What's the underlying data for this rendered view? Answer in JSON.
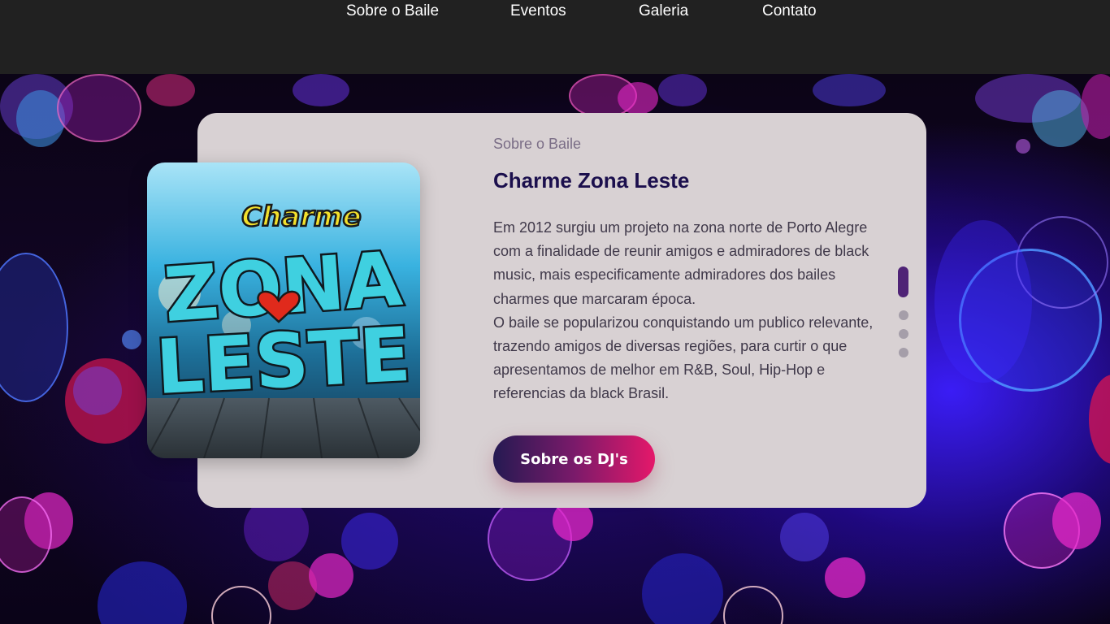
{
  "nav": {
    "items": [
      {
        "label": "Sobre o Baile"
      },
      {
        "label": "Eventos"
      },
      {
        "label": "Galeria"
      },
      {
        "label": "Contato"
      }
    ]
  },
  "about": {
    "subtitle": "Sobre o Baile",
    "title": "Charme Zona Leste",
    "paragraphs": [
      "Em 2012 surgiu um projeto na zona norte de Porto Alegre com a finalidade de reunir amigos e admiradores de black music, mais especificamente admiradores dos bailes charmes que marcaram época.",
      "O baile se popularizou conquistando um publico relevante, trazendo amigos de diversas regiões, para curtir o que apresentamos de melhor em R&B, Soul, Hip-Hop e referencias da black Brasil."
    ],
    "button_label": "Sobre os DJ's",
    "logo_text": {
      "top": "Charme",
      "middle": "ZONA",
      "bottom": "LESTE"
    }
  },
  "pager": {
    "count": 4,
    "active_index": 0
  },
  "colors": {
    "nav_bg": "#212121",
    "card_bg": "#d8d1d3",
    "title": "#1b0f4d",
    "accent_start": "#251a52",
    "accent_end": "#e5186a",
    "pager_active": "#4f2376"
  }
}
